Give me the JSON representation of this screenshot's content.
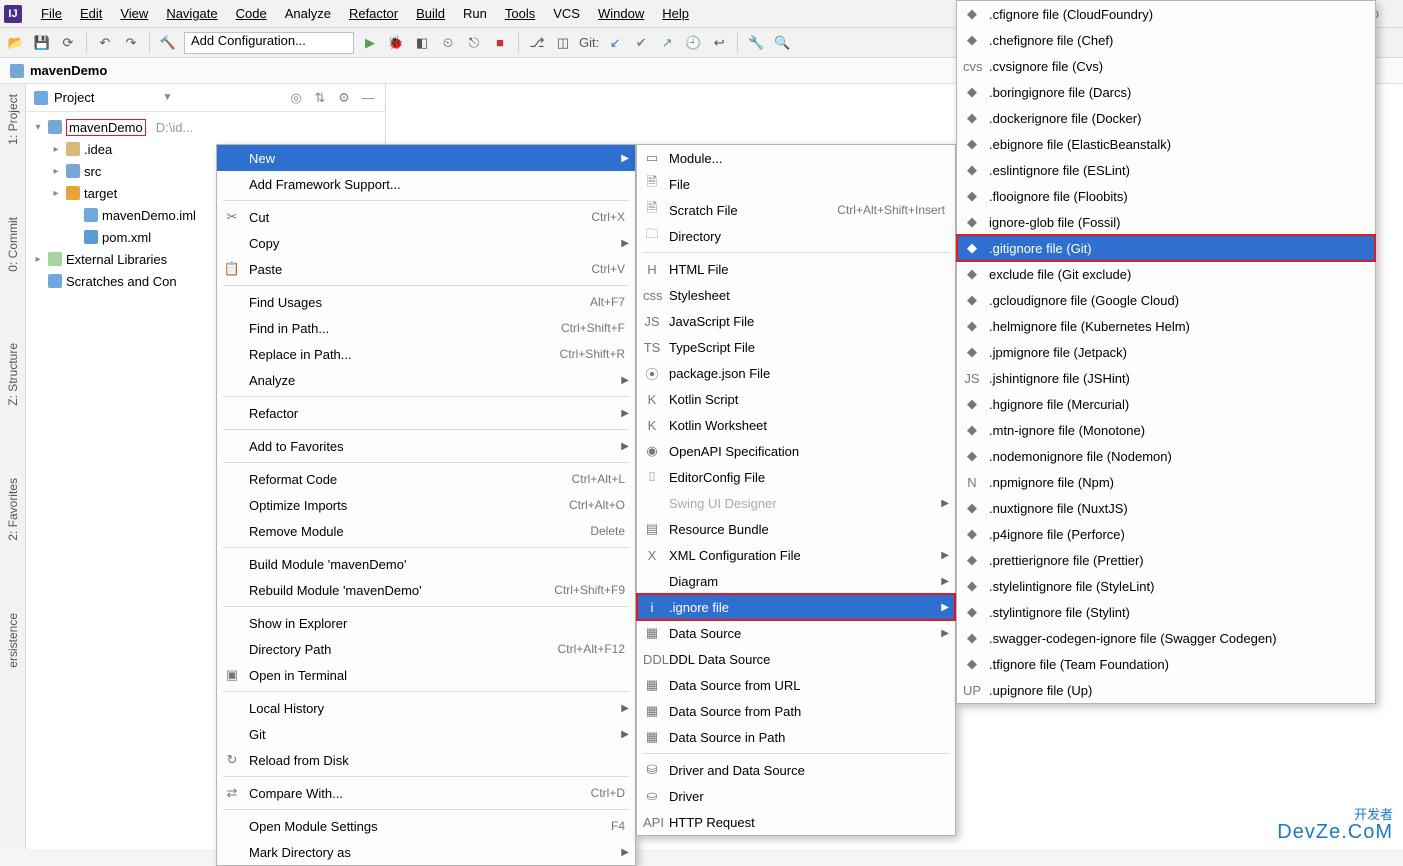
{
  "app": {
    "title": "mavenDemo"
  },
  "menubar": [
    "File",
    "Edit",
    "View",
    "Navigate",
    "Code",
    "Analyze",
    "Refactor",
    "Build",
    "Run",
    "Tools",
    "VCS",
    "Window",
    "Help"
  ],
  "toolbar": {
    "config_combo": "Add Configuration...",
    "git_label": "Git:"
  },
  "breadcrumb": {
    "root": "mavenDemo"
  },
  "left_tabs": [
    "1: Project",
    "0: Commit",
    "Z: Structure",
    "2: Favorites",
    "ersistence"
  ],
  "project_pane": {
    "title": "Project",
    "tree": [
      {
        "depth": 0,
        "arrow": "▾",
        "icon": "ic-folder-blue",
        "label": "mavenDemo",
        "sel": true,
        "hint": "D:\\id..."
      },
      {
        "depth": 1,
        "arrow": "▸",
        "icon": "ic-folder",
        "label": ".idea"
      },
      {
        "depth": 1,
        "arrow": "▸",
        "icon": "ic-folder-blue",
        "label": "src"
      },
      {
        "depth": 1,
        "arrow": "▸",
        "icon": "ic-folder-orange",
        "label": "target"
      },
      {
        "depth": 2,
        "arrow": "",
        "icon": "ic-module",
        "label": "mavenDemo.iml"
      },
      {
        "depth": 2,
        "arrow": "",
        "icon": "ic-pom",
        "label": "pom.xml"
      },
      {
        "depth": 0,
        "arrow": "▸",
        "icon": "ic-lib",
        "label": "External Libraries"
      },
      {
        "depth": 0,
        "arrow": "",
        "icon": "ic-scratch",
        "label": "Scratches and Con"
      }
    ]
  },
  "context_menu": [
    {
      "type": "item",
      "label": "New",
      "highlight": true,
      "submenu": true
    },
    {
      "type": "item",
      "label": "Add Framework Support..."
    },
    {
      "type": "sep"
    },
    {
      "type": "item",
      "icon": "✂",
      "label": "Cut",
      "shortcut": "Ctrl+X"
    },
    {
      "type": "item",
      "label": "Copy",
      "submenu": true
    },
    {
      "type": "item",
      "icon": "📋",
      "label": "Paste",
      "shortcut": "Ctrl+V"
    },
    {
      "type": "sep"
    },
    {
      "type": "item",
      "label": "Find Usages",
      "shortcut": "Alt+F7"
    },
    {
      "type": "item",
      "label": "Find in Path...",
      "shortcut": "Ctrl+Shift+F"
    },
    {
      "type": "item",
      "label": "Replace in Path...",
      "shortcut": "Ctrl+Shift+R"
    },
    {
      "type": "item",
      "label": "Analyze",
      "submenu": true
    },
    {
      "type": "sep"
    },
    {
      "type": "item",
      "label": "Refactor",
      "submenu": true
    },
    {
      "type": "sep"
    },
    {
      "type": "item",
      "label": "Add to Favorites",
      "submenu": true
    },
    {
      "type": "sep"
    },
    {
      "type": "item",
      "label": "Reformat Code",
      "shortcut": "Ctrl+Alt+L"
    },
    {
      "type": "item",
      "label": "Optimize Imports",
      "shortcut": "Ctrl+Alt+O"
    },
    {
      "type": "item",
      "label": "Remove Module",
      "shortcut": "Delete"
    },
    {
      "type": "sep"
    },
    {
      "type": "item",
      "label": "Build Module 'mavenDemo'"
    },
    {
      "type": "item",
      "label": "Rebuild Module 'mavenDemo'",
      "shortcut": "Ctrl+Shift+F9"
    },
    {
      "type": "sep"
    },
    {
      "type": "item",
      "label": "Show in Explorer"
    },
    {
      "type": "item",
      "label": "Directory Path",
      "shortcut": "Ctrl+Alt+F12"
    },
    {
      "type": "item",
      "icon": "▣",
      "label": "Open in Terminal"
    },
    {
      "type": "sep"
    },
    {
      "type": "item",
      "label": "Local History",
      "submenu": true
    },
    {
      "type": "item",
      "label": "Git",
      "submenu": true
    },
    {
      "type": "item",
      "icon": "↻",
      "label": "Reload from Disk"
    },
    {
      "type": "sep"
    },
    {
      "type": "item",
      "icon": "⇄",
      "label": "Compare With...",
      "shortcut": "Ctrl+D"
    },
    {
      "type": "sep"
    },
    {
      "type": "item",
      "label": "Open Module Settings",
      "shortcut": "F4"
    },
    {
      "type": "item",
      "label": "Mark Directory as",
      "submenu": true
    }
  ],
  "new_submenu": [
    {
      "type": "item",
      "icon": "▭",
      "label": "Module..."
    },
    {
      "type": "item",
      "icon": "🗎",
      "label": "File"
    },
    {
      "type": "item",
      "icon": "🗎",
      "label": "Scratch File",
      "shortcut": "Ctrl+Alt+Shift+Insert"
    },
    {
      "type": "item",
      "icon": "🗀",
      "label": "Directory"
    },
    {
      "type": "sep"
    },
    {
      "type": "item",
      "icon": "H",
      "label": "HTML File"
    },
    {
      "type": "item",
      "icon": "css",
      "label": "Stylesheet"
    },
    {
      "type": "item",
      "icon": "JS",
      "label": "JavaScript File"
    },
    {
      "type": "item",
      "icon": "TS",
      "label": "TypeScript File"
    },
    {
      "type": "item",
      "icon": "⦿",
      "label": "package.json File"
    },
    {
      "type": "item",
      "icon": "K",
      "label": "Kotlin Script"
    },
    {
      "type": "item",
      "icon": "K",
      "label": "Kotlin Worksheet"
    },
    {
      "type": "item",
      "icon": "◉",
      "label": "OpenAPI Specification"
    },
    {
      "type": "item",
      "icon": "⌷",
      "label": "EditorConfig File"
    },
    {
      "type": "item",
      "label": "Swing UI Designer",
      "disabled": true,
      "submenu": true
    },
    {
      "type": "item",
      "icon": "▤",
      "label": "Resource Bundle"
    },
    {
      "type": "item",
      "icon": "X",
      "label": "XML Configuration File",
      "submenu": true
    },
    {
      "type": "item",
      "label": "Diagram",
      "submenu": true
    },
    {
      "type": "item",
      "icon": "i",
      "label": ".ignore file",
      "highlight": true,
      "submenu": true,
      "redbox": true
    },
    {
      "type": "item",
      "icon": "▦",
      "label": "Data Source",
      "submenu": true
    },
    {
      "type": "item",
      "icon": "DDL",
      "label": "DDL Data Source"
    },
    {
      "type": "item",
      "icon": "▦",
      "label": "Data Source from URL"
    },
    {
      "type": "item",
      "icon": "▦",
      "label": "Data Source from Path"
    },
    {
      "type": "item",
      "icon": "▦",
      "label": "Data Source in Path"
    },
    {
      "type": "sep"
    },
    {
      "type": "item",
      "icon": "⛁",
      "label": "Driver and Data Source"
    },
    {
      "type": "item",
      "icon": "⛀",
      "label": "Driver"
    },
    {
      "type": "item",
      "icon": "API",
      "label": "HTTP Request"
    }
  ],
  "ignore_submenu": [
    {
      "label": ".cfignore file (CloudFoundry)"
    },
    {
      "label": ".chefignore file (Chef)"
    },
    {
      "label": ".cvsignore file (Cvs)",
      "icon": "cvs"
    },
    {
      "label": ".boringignore file (Darcs)"
    },
    {
      "label": ".dockerignore file (Docker)"
    },
    {
      "label": ".ebignore file (ElasticBeanstalk)"
    },
    {
      "label": ".eslintignore file (ESLint)"
    },
    {
      "label": ".flooignore file (Floobits)"
    },
    {
      "label": "ignore-glob file (Fossil)"
    },
    {
      "label": ".gitignore file (Git)",
      "highlight": true,
      "redbox": true
    },
    {
      "label": "exclude file (Git exclude)"
    },
    {
      "label": ".gcloudignore file (Google Cloud)"
    },
    {
      "label": ".helmignore file (Kubernetes Helm)"
    },
    {
      "label": ".jpmignore file (Jetpack)"
    },
    {
      "label": ".jshintignore file (JSHint)",
      "icon": "JS"
    },
    {
      "label": ".hgignore file (Mercurial)"
    },
    {
      "label": ".mtn-ignore file (Monotone)"
    },
    {
      "label": ".nodemonignore file (Nodemon)"
    },
    {
      "label": ".npmignore file (Npm)",
      "icon": "N"
    },
    {
      "label": ".nuxtignore file (NuxtJS)"
    },
    {
      "label": ".p4ignore file (Perforce)"
    },
    {
      "label": ".prettierignore file (Prettier)"
    },
    {
      "label": ".stylelintignore file (StyleLint)"
    },
    {
      "label": ".stylintignore file (Stylint)"
    },
    {
      "label": ".swagger-codegen-ignore file (Swagger Codegen)"
    },
    {
      "label": ".tfignore file (Team Foundation)"
    },
    {
      "label": ".upignore file (Up)",
      "icon": "UP"
    }
  ],
  "watermark": {
    "line1": "开发者",
    "line2": "DevZe.CoM"
  }
}
